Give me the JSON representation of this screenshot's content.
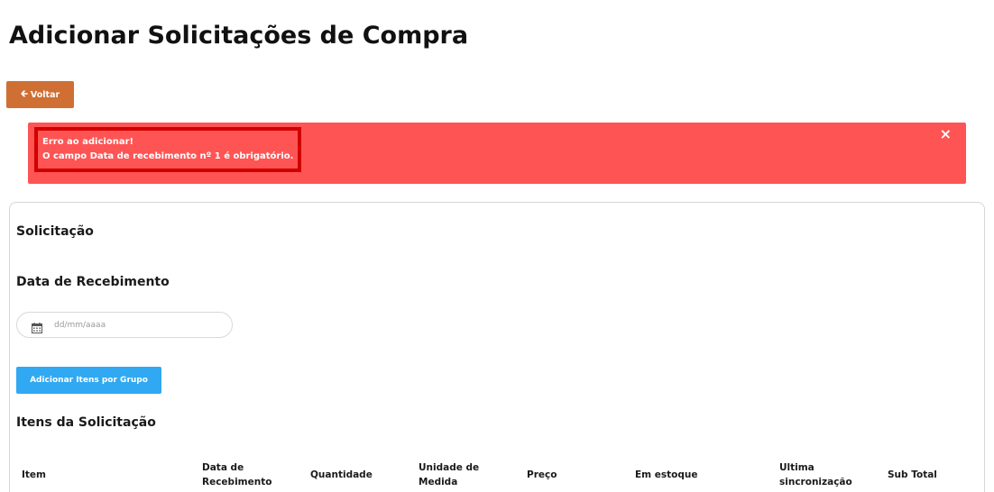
{
  "page": {
    "title": "Adicionar Solicitações de Compra"
  },
  "toolbar": {
    "back_label": "Voltar"
  },
  "alert": {
    "title": "Erro ao adicionar!",
    "message": "O campo Data de recebimento nº 1 é obrigatório.",
    "close_label": "×",
    "color": "#ff5454"
  },
  "form": {
    "section_title": "Solicitação",
    "date_label": "Data de Recebimento",
    "date_placeholder": "dd/mm/aaaa",
    "date_icon": "calendar-icon",
    "group_button_label": "Adicionar Itens por Grupo",
    "items_title": "Itens da Solicitação"
  },
  "table": {
    "columns": [
      {
        "line1": "Item",
        "line2": ""
      },
      {
        "line1": "Data de",
        "line2": "Recebimento"
      },
      {
        "line1": "Quantidade",
        "line2": ""
      },
      {
        "line1": "Unidade de",
        "line2": "Medida"
      },
      {
        "line1": "Preço",
        "line2": ""
      },
      {
        "line1": "Em estoque",
        "line2": ""
      },
      {
        "line1": "Ultima",
        "line2": "sincronização"
      },
      {
        "line1": "Sub Total",
        "line2": ""
      }
    ]
  },
  "colors": {
    "back_button": "#cf6f34",
    "primary_button": "#30a8f2",
    "alert_border": "#d10000"
  }
}
